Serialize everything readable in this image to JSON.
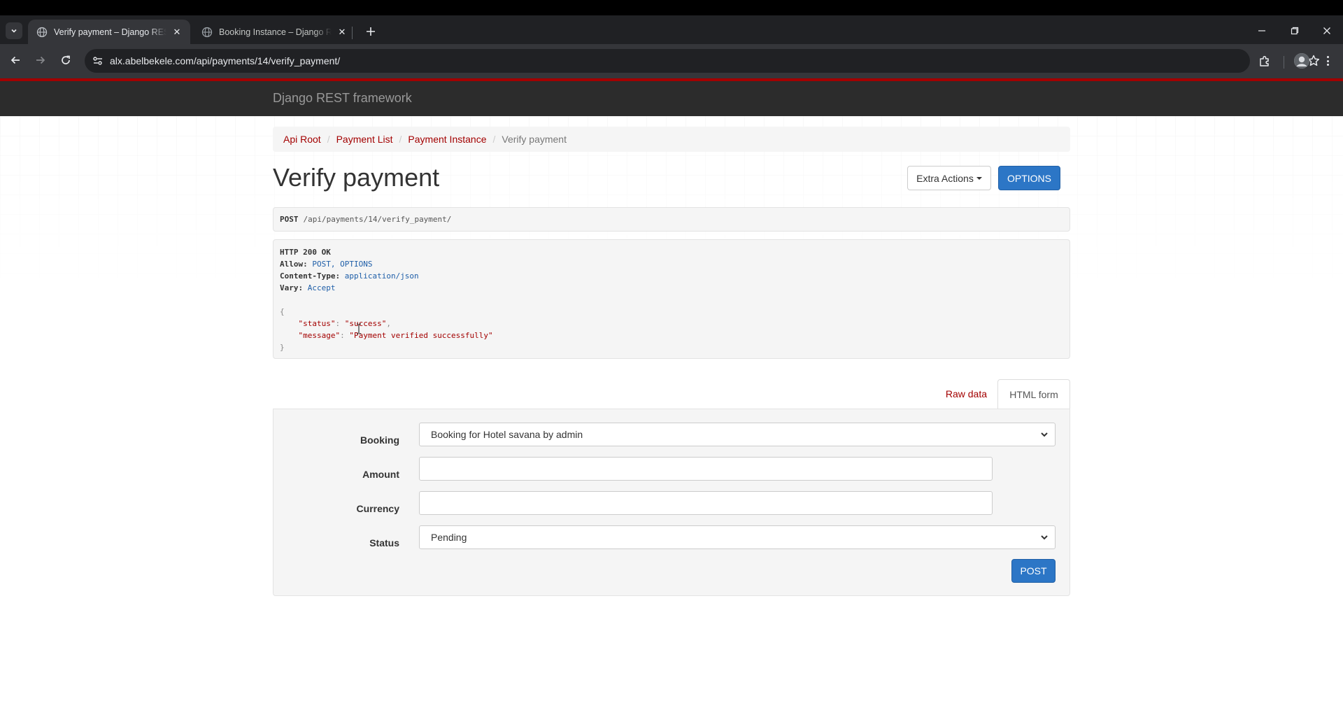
{
  "browser": {
    "tabs": [
      {
        "title": "Verify payment – Django REST f",
        "active": true
      },
      {
        "title": "Booking Instance – Django RES",
        "active": false
      }
    ],
    "url": "alx.abelbekele.com/api/payments/14/verify_payment/",
    "icons": {
      "tab_list": "chevron-down-icon",
      "new_tab": "plus-icon",
      "back": "arrow-left-icon",
      "forward": "arrow-right-icon",
      "reload": "reload-icon",
      "site_info": "tune-icon",
      "bookmark": "star-icon",
      "extensions": "puzzle-icon",
      "menu": "kebab-menu-icon"
    }
  },
  "navbar": {
    "brand": "Django REST framework",
    "accent_color": "#a30000",
    "background_color": "#2c2c2c"
  },
  "breadcrumb": {
    "items": [
      "Api Root",
      "Payment List",
      "Payment Instance"
    ],
    "current": "Verify payment"
  },
  "page": {
    "title": "Verify payment",
    "extra_actions_label": "Extra Actions",
    "options_label": "OPTIONS"
  },
  "request": {
    "method": "POST",
    "path": "/api/payments/14/verify_payment/"
  },
  "response": {
    "status_line": "HTTP 200 OK",
    "headers": [
      {
        "name": "Allow:",
        "value": "POST, OPTIONS"
      },
      {
        "name": "Content-Type:",
        "value": "application/json"
      },
      {
        "name": "Vary:",
        "value": "Accept"
      }
    ],
    "body": {
      "open": "{",
      "fields": [
        {
          "key": "\"status\"",
          "value": "\"success\"",
          "trail": ","
        },
        {
          "key": "\"message\"",
          "value": "\"Payment verified successfully\"",
          "trail": ""
        }
      ],
      "close": "}"
    }
  },
  "form": {
    "tabs": {
      "raw": "Raw data",
      "html": "HTML form",
      "active": "HTML form"
    },
    "fields": {
      "booking": {
        "label": "Booking",
        "value": "Booking for Hotel savana by admin"
      },
      "amount": {
        "label": "Amount",
        "value": ""
      },
      "currency": {
        "label": "Currency",
        "value": ""
      },
      "status": {
        "label": "Status",
        "value": "Pending"
      }
    },
    "submit_label": "POST"
  },
  "colors": {
    "primary_button": "#2c76c6",
    "link": "#a30000"
  }
}
